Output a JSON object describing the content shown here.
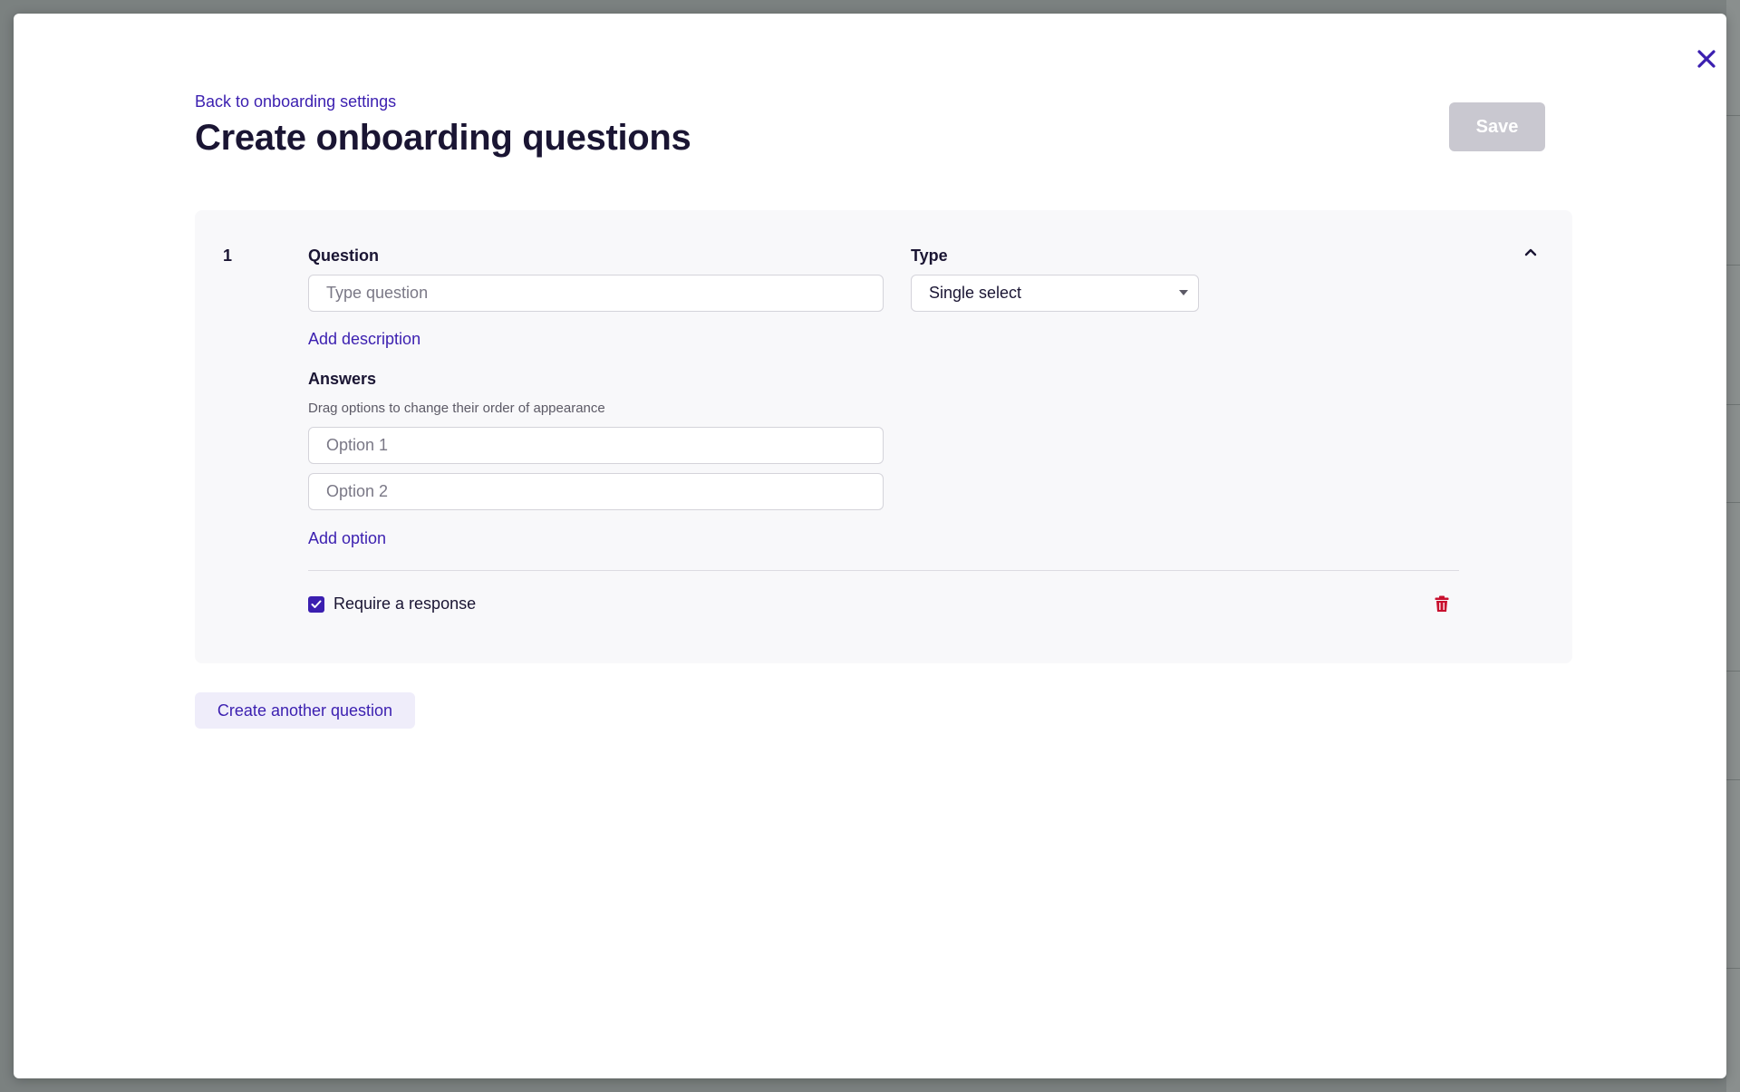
{
  "header": {
    "back_link": "Back to onboarding settings",
    "title": "Create onboarding questions",
    "save_label": "Save",
    "close_icon": "close-icon"
  },
  "question": {
    "number": "1",
    "question_label": "Question",
    "question_placeholder": "Type question",
    "type_label": "Type",
    "type_value": "Single select",
    "add_description": "Add description",
    "answers_label": "Answers",
    "answers_helper": "Drag options to change their order of appearance",
    "options": [
      {
        "placeholder": "Option 1"
      },
      {
        "placeholder": "Option 2"
      }
    ],
    "add_option": "Add option",
    "require_label": "Require a response",
    "require_checked": true
  },
  "footer": {
    "create_another": "Create another question"
  },
  "colors": {
    "accent": "#3b1fb0",
    "title": "#1a1533",
    "save_disabled": "#c9c8d0",
    "danger": "#c8102e",
    "card_bg": "#f8f8fa"
  }
}
